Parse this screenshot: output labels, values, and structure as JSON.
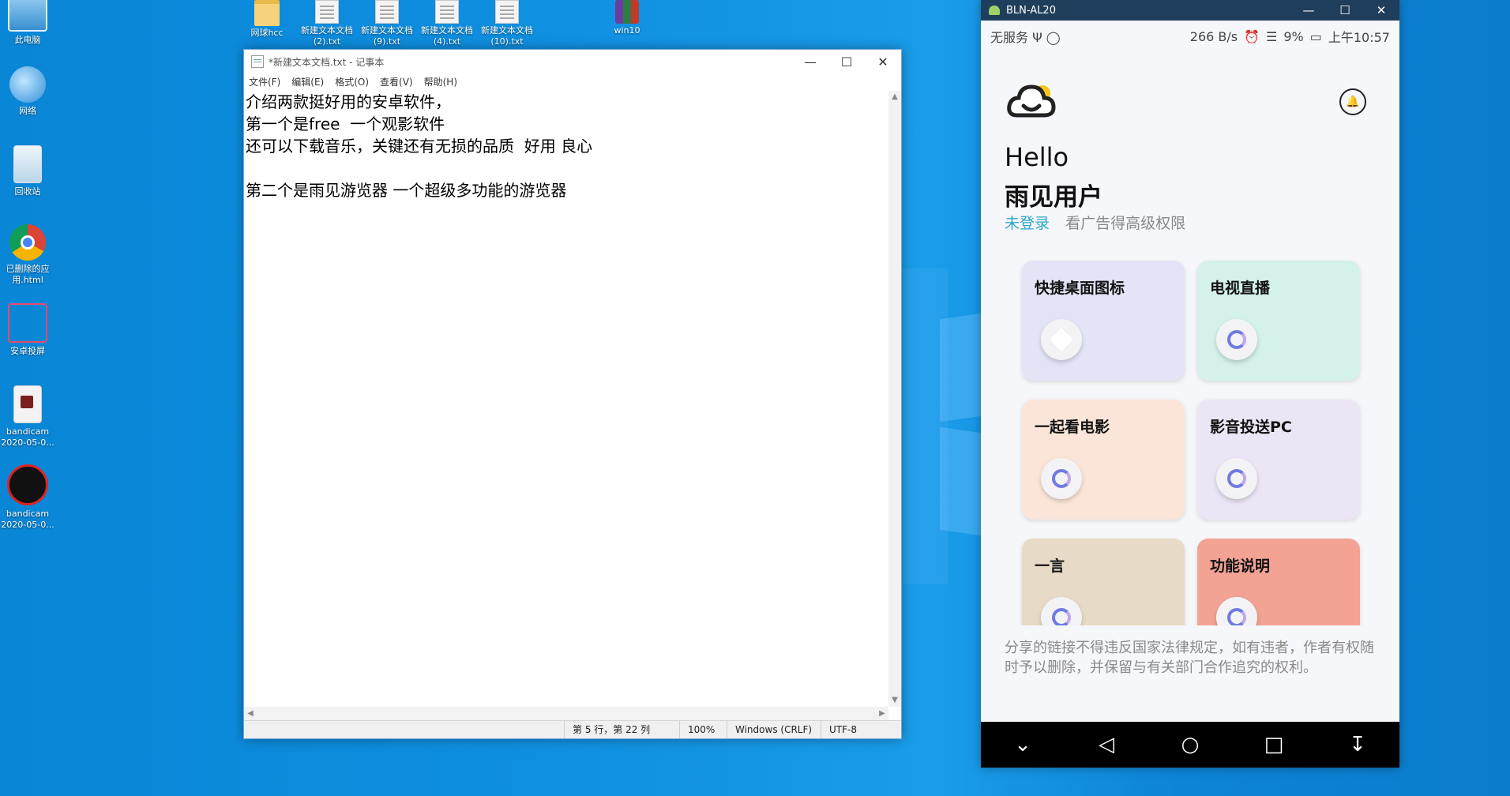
{
  "desktop": {
    "left_icons": [
      {
        "label": "此电脑"
      },
      {
        "label": "网络"
      },
      {
        "label": "回收站"
      },
      {
        "label": "已删除的应用.html"
      },
      {
        "label": "安卓投屏"
      },
      {
        "label": "bandicam 2020-05-0..."
      },
      {
        "label": "bandicam 2020-05-0..."
      }
    ],
    "top_files": [
      {
        "label": "网球hcc"
      },
      {
        "label": "新建文本文档 (2).txt"
      },
      {
        "label": "新建文本文档 (9).txt"
      },
      {
        "label": "新建文本文档 (4).txt"
      },
      {
        "label": "新建文本文档 (10).txt"
      },
      {
        "label": "win10"
      }
    ]
  },
  "notepad": {
    "title": "*新建文本文档.txt - 记事本",
    "menu": [
      "文件(F)",
      "编辑(E)",
      "格式(O)",
      "查看(V)",
      "帮助(H)"
    ],
    "content": "介绍两款挺好用的安卓软件，\n第一个是free  一个观影软件\n还可以下载音乐，关键还有无损的品质  好用 良心\n\n第二个是雨见游览器 一个超级多功能的游览器",
    "status": {
      "position": "第 5 行，第 22 列",
      "zoom": "100%",
      "line_ending": "Windows (CRLF)",
      "encoding": "UTF-8"
    }
  },
  "phone_window": {
    "title": "BLN-AL20",
    "status_bar": {
      "carrier": "无服务",
      "speed": "266 B/s",
      "battery": "9%",
      "time": "上午10:57"
    },
    "app": {
      "greeting": "Hello",
      "username": "雨见用户",
      "login_link": "未登录",
      "login_hint": "看广告得高级权限",
      "cards": [
        {
          "title": "快捷桌面图标",
          "color": "#e4e4f7",
          "icon": "diamond-icon"
        },
        {
          "title": "电视直播",
          "color": "#d4f1ec",
          "icon": "browser-e-icon"
        },
        {
          "title": "一起看电影",
          "color": "#fbe5d8",
          "icon": "browser-e-icon"
        },
        {
          "title": "影音投送PC",
          "color": "#ebe5f5",
          "icon": "browser-e-icon"
        },
        {
          "title": "一言",
          "color": "#e7dac6",
          "icon": "browser-e-icon"
        },
        {
          "title": "功能说明",
          "color": "#f2a394",
          "icon": "browser-e-icon"
        }
      ],
      "legal_text": "分享的链接不得违反国家法律规定，如有违者，作者有权随时予以删除，并保留与有关部门合作追究的权利。"
    },
    "navbar": [
      "chevron-down-icon",
      "back-icon",
      "home-icon",
      "recents-icon",
      "menu-icon"
    ]
  }
}
